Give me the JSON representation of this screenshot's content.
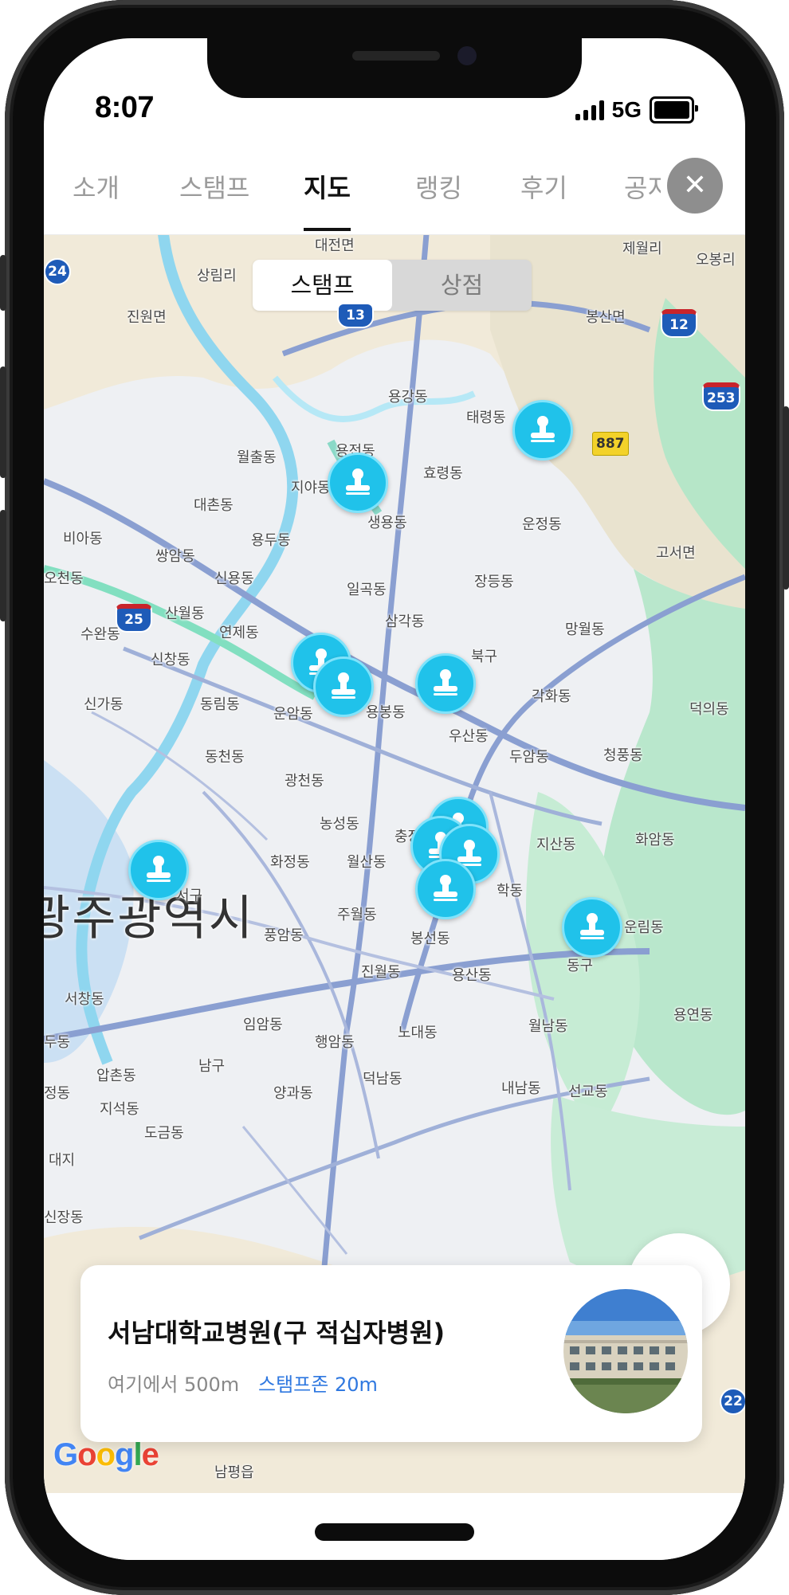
{
  "status": {
    "time": "8:07",
    "network": "5G"
  },
  "tabs": [
    {
      "label": "소개",
      "active": false
    },
    {
      "label": "스탬프",
      "active": false
    },
    {
      "label": "지도",
      "active": true
    },
    {
      "label": "랭킹",
      "active": false
    },
    {
      "label": "후기",
      "active": false
    },
    {
      "label": "공지",
      "active": false
    }
  ],
  "close_icon": "close-icon",
  "map": {
    "segment": {
      "options": [
        "스탬프",
        "상점"
      ],
      "selected": "스탬프"
    },
    "city_label": "광주광역시",
    "places": [
      "대전면",
      "제월리",
      "오봉리",
      "상림리",
      "진원면",
      "봉산면",
      "용강동",
      "태령동",
      "월출동",
      "용전동",
      "지야동",
      "효령동",
      "대촌동",
      "생용동",
      "운정동",
      "비아동",
      "용두동",
      "쌍암동",
      "고서면",
      "오천동",
      "신용동",
      "일곡동",
      "장등동",
      "산월동",
      "삼각동",
      "망월동",
      "수완동",
      "연제동",
      "북구",
      "신창동",
      "각화동",
      "신가동",
      "동림동",
      "운암동",
      "용봉동",
      "덕의동",
      "우산동",
      "두암동",
      "동천동",
      "청풍동",
      "광천동",
      "농성동",
      "충장",
      "지산동",
      "화암동",
      "화정동",
      "월산동",
      "서구",
      "학동",
      "주월동",
      "운림동",
      "풍암동",
      "봉선동",
      "동구",
      "진월동",
      "서창동",
      "용산동",
      "임암동",
      "용연동",
      "두동",
      "행암동",
      "노대동",
      "월남동",
      "남구",
      "압촌동",
      "덕남동",
      "정동",
      "지석동",
      "양과동",
      "내남동",
      "선교동",
      "도금동",
      "대지",
      "신장동",
      "남평읍"
    ],
    "road_shields": [
      "24",
      "13",
      "12",
      "253",
      "887",
      "25",
      "22"
    ],
    "stamp_pins": 12,
    "attribution": "Google"
  },
  "card": {
    "title": "서남대학교병원(구 적십자병원)",
    "distance": "여기에서 500m",
    "zone": "스탬프존 20m"
  },
  "colors": {
    "accent": "#20c2ea",
    "zone_text": "#2f78e0",
    "close_button": "#8e8e8e"
  }
}
